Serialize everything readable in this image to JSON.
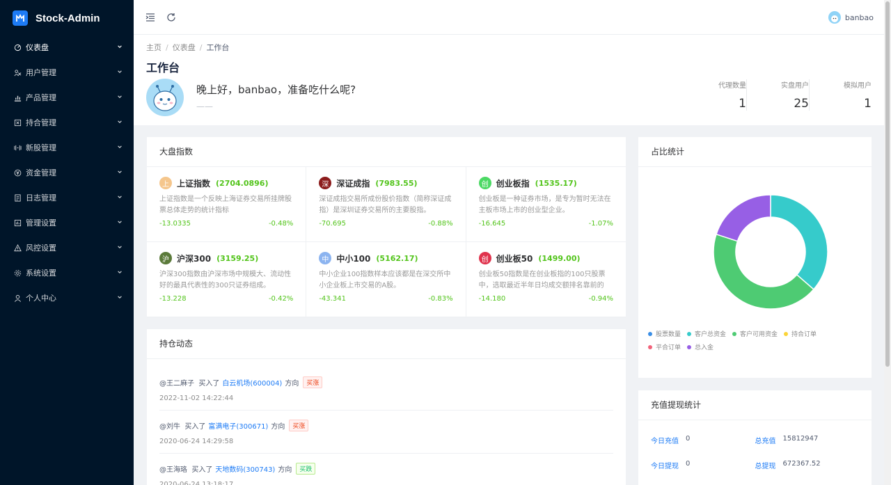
{
  "app": {
    "title": "Stock-Admin"
  },
  "sidebar": {
    "items": [
      {
        "label": "仪表盘",
        "icon": "dashboard-icon",
        "active": true
      },
      {
        "label": "用户管理",
        "icon": "users-icon"
      },
      {
        "label": "产品管理",
        "icon": "chart-icon"
      },
      {
        "label": "持合管理",
        "icon": "box-icon"
      },
      {
        "label": "新股管理",
        "icon": "stock-icon"
      },
      {
        "label": "资金管理",
        "icon": "money-icon"
      },
      {
        "label": "日志管理",
        "icon": "log-icon"
      },
      {
        "label": "管理设置",
        "icon": "settings-panel-icon"
      },
      {
        "label": "风控设置",
        "icon": "warning-icon"
      },
      {
        "label": "系统设置",
        "icon": "gear-icon"
      },
      {
        "label": "个人中心",
        "icon": "user-icon"
      }
    ]
  },
  "header": {
    "user": "banbao"
  },
  "breadcrumb": [
    "主页",
    "仪表盘",
    "工作台"
  ],
  "page": {
    "title": "工作台",
    "greeting": "晚上好，banbao，准备吃什么呢?",
    "greeting_sub": "——"
  },
  "stats": [
    {
      "label": "代理数量",
      "value": "1"
    },
    {
      "label": "实盘用户",
      "value": "25"
    },
    {
      "label": "模拟用户",
      "value": "1"
    }
  ],
  "market": {
    "title": "大盘指数",
    "indices": [
      {
        "icon_char": "上",
        "icon_color": "#f5c68c",
        "name": "上证指数",
        "value": "(2704.0896)",
        "desc": "上证指数是一个反映上海证券交易所挂牌股票总体走势的统计指标",
        "change": "-13.0335",
        "pct": "-0.48%"
      },
      {
        "icon_char": "深",
        "icon_color": "#8c1c1c",
        "name": "深证成指",
        "value": "(7983.55)",
        "desc": "深证成指交易所成份股价指数（简称深证成指）是深圳证券交易所的主要股指。",
        "change": "-70.695",
        "pct": "-0.88%"
      },
      {
        "icon_char": "创",
        "icon_color": "#4cd964",
        "name": "创业板指",
        "value": "(1535.17)",
        "desc": "创业板是一种证券市场，是专为暂时无法在主板市场上市的创业型企业。",
        "change": "-16.645",
        "pct": "-1.07%"
      },
      {
        "icon_char": "沪",
        "icon_color": "#5b7a3a",
        "name": "沪深300",
        "value": "(3159.25)",
        "desc": "沪深300指数由沪深市场中规模大、流动性好的最具代表性的300只证券组成。",
        "change": "-13.228",
        "pct": "-0.42%"
      },
      {
        "icon_char": "中",
        "icon_color": "#8cb4f0",
        "name": "中小100",
        "value": "(5162.17)",
        "desc": "中小企业100指数样本应该都是在深交所中小企业板上市交易的A股。",
        "change": "-43.341",
        "pct": "-0.83%"
      },
      {
        "icon_char": "创",
        "icon_color": "#e0334d",
        "name": "创业板50",
        "value": "(1499.00)",
        "desc": "创业板50指数是在创业板指的100只股票中，选取最近半年日均成交额排名靠前的",
        "change": "-14.180",
        "pct": "-0.94%"
      }
    ]
  },
  "positions": {
    "title": "持仓动态",
    "items": [
      {
        "user": "@王二麻子",
        "action": "买入了",
        "stock": "白云机场(600004)",
        "dir_label": "方向",
        "tag": "买涨",
        "tag_type": "up",
        "time": "2022-11-02 14:22:44"
      },
      {
        "user": "@刘牛",
        "action": "买入了",
        "stock": "富满电子(300671)",
        "dir_label": "方向",
        "tag": "买涨",
        "tag_type": "up",
        "time": "2020-06-24 14:29:58"
      },
      {
        "user": "@王海珞",
        "action": "买入了",
        "stock": "天地数码(300743)",
        "dir_label": "方向",
        "tag": "买跌",
        "tag_type": "down",
        "time": "2020-06-24 13:18:17"
      }
    ]
  },
  "ratio": {
    "title": "占比统计",
    "legend": [
      {
        "label": "股票数量",
        "color": "#3a8ee6"
      },
      {
        "label": "客户总资金",
        "color": "#36cbcb"
      },
      {
        "label": "客户可用资金",
        "color": "#4ecb73"
      },
      {
        "label": "持合订单",
        "color": "#fbd437"
      },
      {
        "label": "平合订单",
        "color": "#f2637b"
      },
      {
        "label": "总入金",
        "color": "#975fe5"
      }
    ]
  },
  "chart_data": {
    "type": "pie",
    "title": "",
    "series": [
      {
        "name": "股票数量",
        "value": 0,
        "color": "#3a8ee6"
      },
      {
        "name": "客户总资金",
        "value": 36.4,
        "color": "#36cbcb"
      },
      {
        "name": "客户可用资金",
        "value": 43.6,
        "color": "#4ecb73"
      },
      {
        "name": "持合订单",
        "value": 0,
        "color": "#fbd437"
      },
      {
        "name": "平合订单",
        "value": 0,
        "color": "#f2637b"
      },
      {
        "name": "总入金",
        "value": 20.0,
        "color": "#975fe5"
      }
    ],
    "legend_position": "bottom"
  },
  "funds": {
    "title": "充值提现统计",
    "rows": [
      [
        {
          "label": "今日充值",
          "value": "0"
        },
        {
          "label": "总充值",
          "value": "15812947"
        }
      ],
      [
        {
          "label": "今日提现",
          "value": "0"
        },
        {
          "label": "总提现",
          "value": "672367.52"
        }
      ]
    ]
  }
}
